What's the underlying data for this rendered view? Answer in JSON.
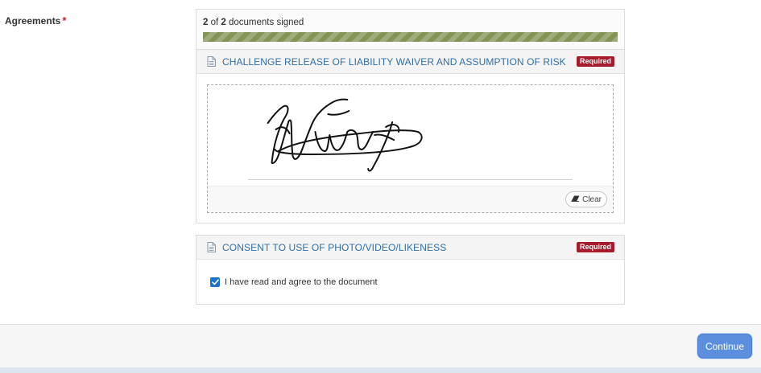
{
  "field": {
    "label": "Agreements",
    "required_marker": "*"
  },
  "progress": {
    "signed_count": "2",
    "of_word": " of ",
    "total_count": "2",
    "suffix": " documents signed",
    "fraction": 1.0,
    "color": "#849455"
  },
  "documents": [
    {
      "title": "CHALLENGE RELEASE OF LIABILITY WAIVER AND ASSUMPTION OF RISK",
      "badge": "Required",
      "signature": {
        "clear_label": "Clear"
      }
    },
    {
      "title": "CONSENT TO USE OF PHOTO/VIDEO/LIKENESS",
      "badge": "Required",
      "checkbox_label": "I have read and agree to the document",
      "checked": true
    }
  ],
  "footer": {
    "continue_label": "Continue"
  },
  "colors": {
    "link": "#2f6ea6",
    "badge": "#a61c2c",
    "primary": "#5b8fde"
  }
}
